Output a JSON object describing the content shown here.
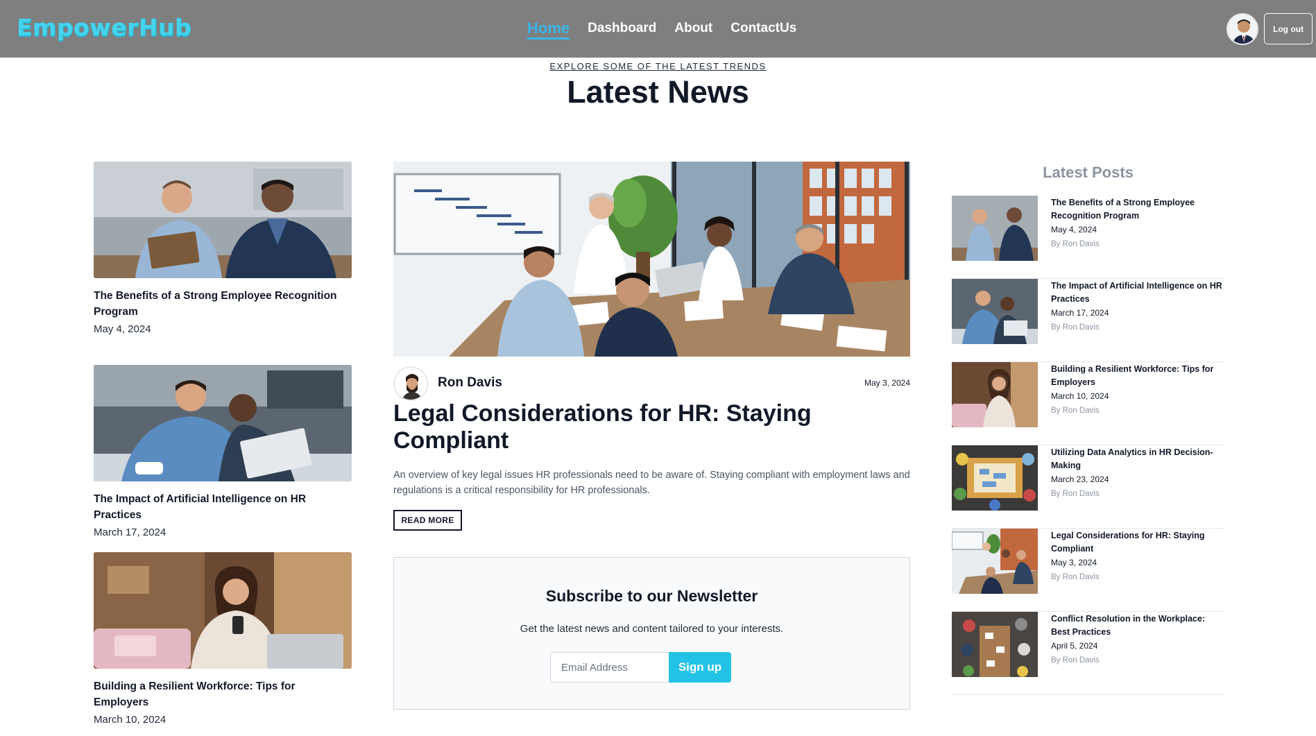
{
  "navbar": {
    "logo": "EmpowerHub",
    "links": [
      {
        "label": "Home",
        "active": true
      },
      {
        "label": "Dashboard",
        "active": false
      },
      {
        "label": "About",
        "active": false
      },
      {
        "label": "ContactUs",
        "active": false
      }
    ],
    "logout_label": "Log out",
    "accent_color": "#3bb6e8"
  },
  "hero_header": {
    "eyebrow": "EXPLORE SOME OF THE LATEST TRENDS",
    "title": "Latest News"
  },
  "left_articles": [
    {
      "title": "The Benefits of a Strong Employee Recognition Program",
      "date": "May 4, 2024"
    },
    {
      "title": "The Impact of Artificial Intelligence on HR Practices",
      "date": "March 17, 2024"
    },
    {
      "title": "Building a Resilient Workforce: Tips for Employers",
      "date": "March 10, 2024"
    }
  ],
  "featured": {
    "author": "Ron Davis",
    "date": "May 3, 2024",
    "title": "Legal Considerations for HR: Staying Compliant",
    "excerpt": "An overview of key legal issues HR professionals need to be aware of. Staying compliant with employment laws and regulations is a critical responsibility for HR professionals.",
    "read_more": "READ MORE"
  },
  "newsletter": {
    "title": "Subscribe to our Newsletter",
    "subtitle": "Get the latest news and content tailored to your interests.",
    "email_placeholder": "Email Address",
    "button": "Sign up",
    "button_color": "#22c3e6"
  },
  "sidebar": {
    "title": "Latest Posts",
    "posts": [
      {
        "title": "The Benefits of a Strong Employee Recognition Program",
        "date": "May 4, 2024",
        "by": "By Ron Davis"
      },
      {
        "title": "The Impact of Artificial Intelligence on HR Practices",
        "date": "March 17, 2024",
        "by": "By Ron Davis"
      },
      {
        "title": "Building a Resilient Workforce: Tips for Employers",
        "date": "March 10, 2024",
        "by": "By Ron Davis"
      },
      {
        "title": "Utilizing Data Analytics in HR Decision-Making",
        "date": "March 23, 2024",
        "by": "By Ron Davis"
      },
      {
        "title": "Legal Considerations for HR: Staying Compliant",
        "date": "May 3, 2024",
        "by": "By Ron Davis"
      },
      {
        "title": "Conflict Resolution in the Workplace: Best Practices",
        "date": "April 5, 2024",
        "by": "By Ron Davis"
      }
    ]
  }
}
